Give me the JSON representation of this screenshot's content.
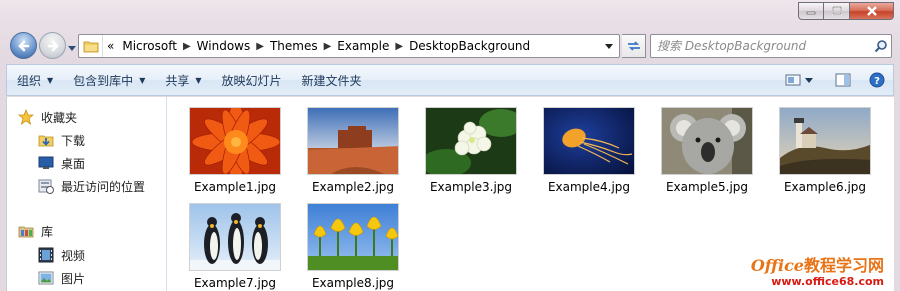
{
  "window": {
    "caption_buttons": [
      "minimize",
      "maximize",
      "close"
    ]
  },
  "navigation": {
    "breadcrumbs": [
      "Microsoft",
      "Windows",
      "Themes",
      "Example",
      "DesktopBackground"
    ],
    "overflow_glyph": "«",
    "search_placeholder": "搜索 DesktopBackground"
  },
  "toolbar": {
    "organize_label": "组织",
    "include_library_label": "包含到库中",
    "share_label": "共享",
    "slideshow_label": "放映幻灯片",
    "new_folder_label": "新建文件夹",
    "right_icons": [
      "view-options-icon",
      "preview-pane-icon",
      "help-icon"
    ]
  },
  "sidebar": {
    "favorites_label": "收藏夹",
    "favorites": [
      {
        "label": "下载",
        "icon": "download-folder-icon"
      },
      {
        "label": "桌面",
        "icon": "desktop-icon"
      },
      {
        "label": "最近访问的位置",
        "icon": "recent-places-icon"
      }
    ],
    "libraries_label": "库",
    "libraries": [
      {
        "label": "视频",
        "icon": "video-library-icon"
      },
      {
        "label": "图片",
        "icon": "picture-library-icon"
      }
    ]
  },
  "files": [
    {
      "name": "Example1.jpg",
      "subject": "orange chrysanthemum"
    },
    {
      "name": "Example2.jpg",
      "subject": "desert mesa"
    },
    {
      "name": "Example3.jpg",
      "subject": "white hydrangea"
    },
    {
      "name": "Example4.jpg",
      "subject": "jellyfish"
    },
    {
      "name": "Example5.jpg",
      "subject": "koala"
    },
    {
      "name": "Example6.jpg",
      "subject": "lighthouse"
    },
    {
      "name": "Example7.jpg",
      "subject": "penguins"
    },
    {
      "name": "Example8.jpg",
      "subject": "yellow tulips"
    }
  ],
  "watermark": {
    "line1_latin": "Office",
    "line1_cn": "教程学习网",
    "line2": "www.office68.com"
  },
  "colors": {
    "toolbar_text": "#1e395b",
    "watermark_orange": "#e87418",
    "watermark_red": "#d81b12"
  }
}
